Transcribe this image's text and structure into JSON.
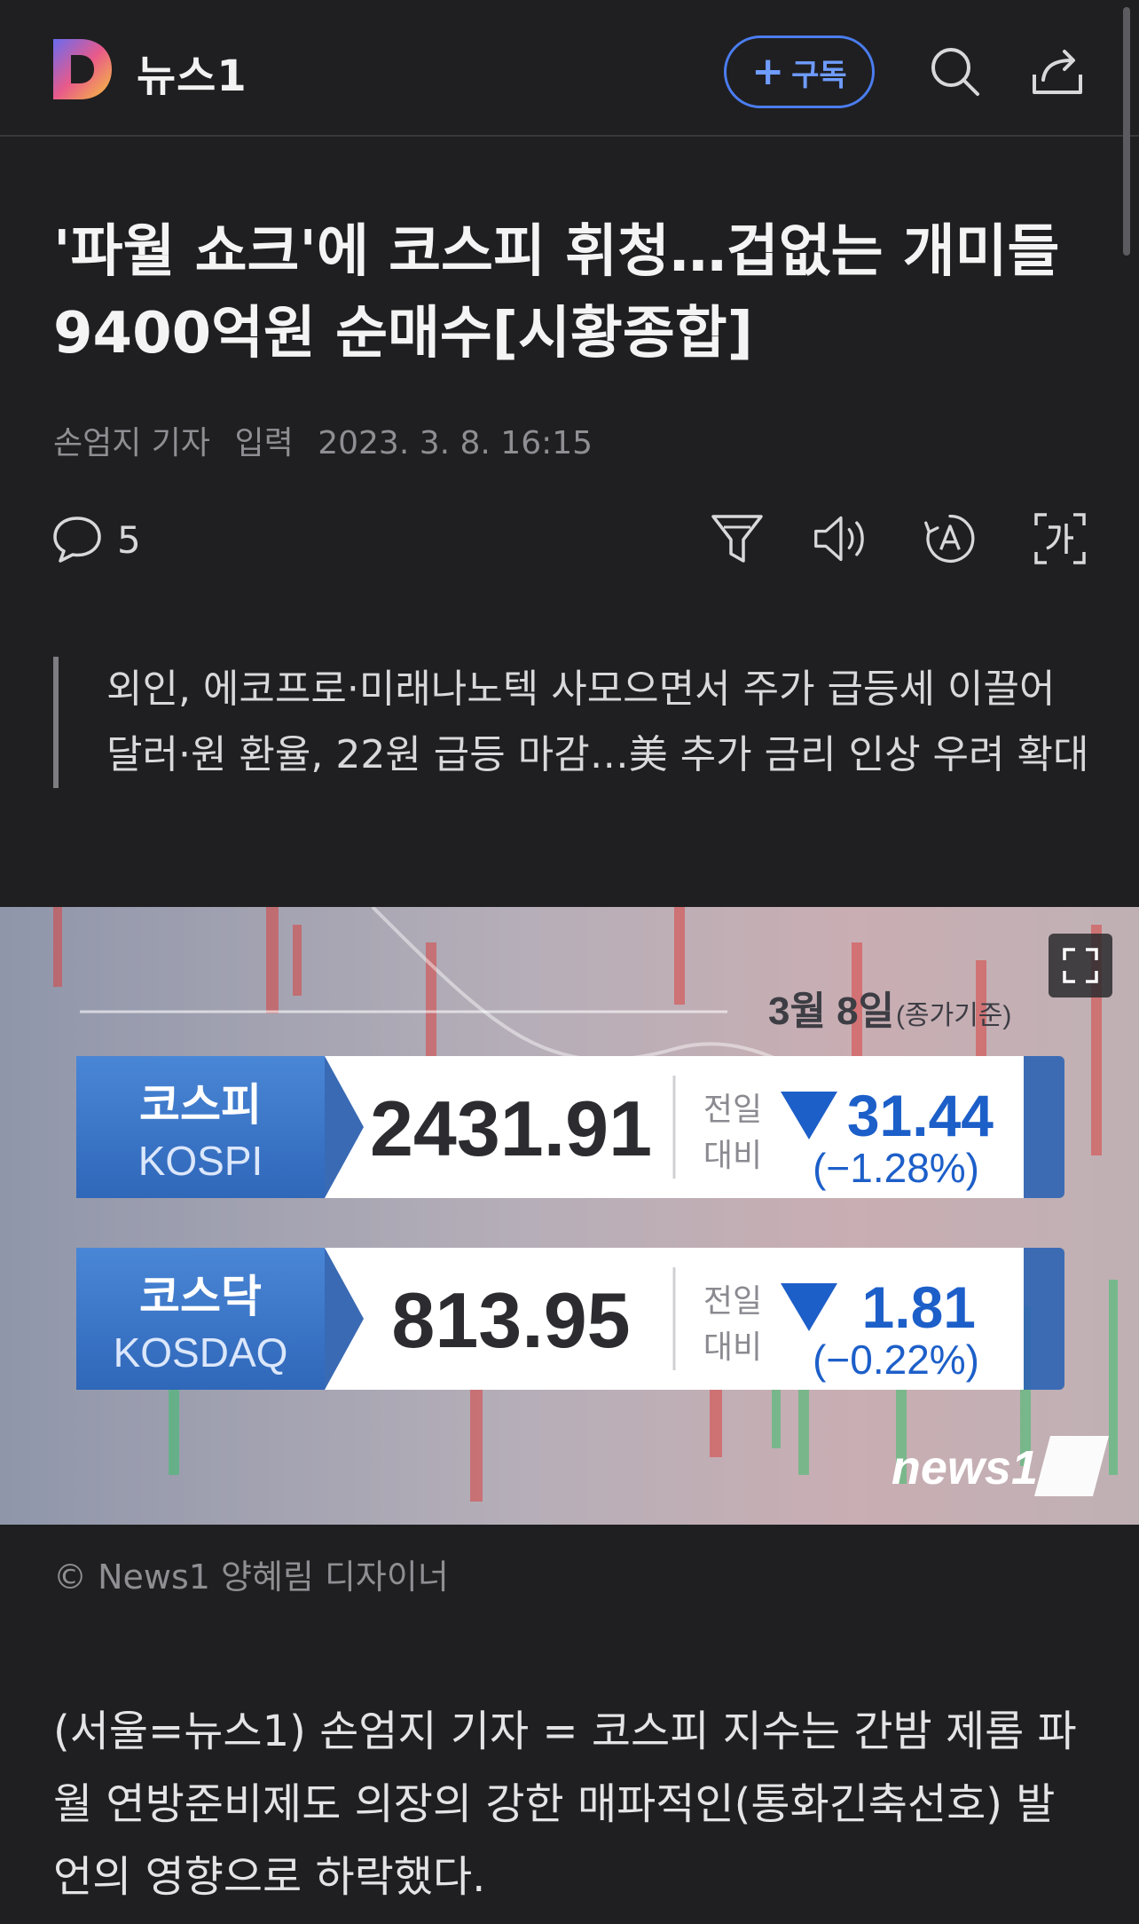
{
  "header": {
    "brand": "뉴스1",
    "subscribe_label": "구독",
    "subscribe_plus": "+"
  },
  "article": {
    "title": "'파월 쇼크'에 코스피 휘청…겁없는 개미들 9400억원 순매수[시황종합]",
    "author": "손엄지 기자",
    "input_label": "입력",
    "timestamp": "2023. 3. 8. 16:15",
    "comment_count": "5",
    "summary": [
      "외인, 에코프로·미래나노텍 사모으면서 주가 급등세 이끌어",
      "달러·원 환율, 22원 급등 마감…美 추가 금리 인상 우려 확대"
    ],
    "image_caption": "© News1 양혜림 디자이너",
    "body": "(서울=뉴스1) 손엄지 기자 = 코스피 지수는 간밤 제롬 파월 연방준비제도 의장의 강한 매파적인(통화긴축선호) 발언의 영향으로 하락했다."
  },
  "figure": {
    "date_label": "3월 8일",
    "date_note": "(종가기준)",
    "compare_label_1": "전일",
    "compare_label_2": "대비",
    "indices": [
      {
        "name_kr": "코스피",
        "name_en": "KOSPI",
        "value": "2431.91",
        "change": "31.44",
        "change_pct": "(−1.28%)"
      },
      {
        "name_kr": "코스닥",
        "name_en": "KOSDAQ",
        "value": "813.95",
        "change": "1.81",
        "change_pct": "(−0.22%)"
      }
    ],
    "watermark": "news1"
  },
  "colors": {
    "background": "#1f1f21",
    "accent_blue": "#4b7df0",
    "index_blue": "#3a76c8",
    "down_blue": "#1d5fc9"
  },
  "icons": [
    "logo-d-icon",
    "plus-icon",
    "search-icon",
    "share-icon",
    "comment-icon",
    "filter-icon",
    "speaker-icon",
    "font-size-icon",
    "translate-icon",
    "expand-icon",
    "down-triangle-icon"
  ]
}
